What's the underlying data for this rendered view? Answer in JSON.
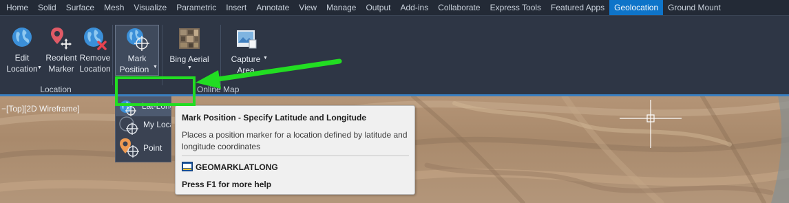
{
  "tabs": [
    {
      "label": "Home",
      "active": false
    },
    {
      "label": "Solid",
      "active": false
    },
    {
      "label": "Surface",
      "active": false
    },
    {
      "label": "Mesh",
      "active": false
    },
    {
      "label": "Visualize",
      "active": false
    },
    {
      "label": "Parametric",
      "active": false
    },
    {
      "label": "Insert",
      "active": false
    },
    {
      "label": "Annotate",
      "active": false
    },
    {
      "label": "View",
      "active": false
    },
    {
      "label": "Manage",
      "active": false
    },
    {
      "label": "Output",
      "active": false
    },
    {
      "label": "Add-ins",
      "active": false
    },
    {
      "label": "Collaborate",
      "active": false
    },
    {
      "label": "Express Tools",
      "active": false
    },
    {
      "label": "Featured Apps",
      "active": false
    },
    {
      "label": "Geolocation",
      "active": true
    },
    {
      "label": "Ground Mount",
      "active": false
    }
  ],
  "location_panel": {
    "title": "Location",
    "edit_location": {
      "line1": "Edit",
      "line2": "Location"
    },
    "reorient_marker": {
      "line1": "Reorient",
      "line2": "Marker"
    },
    "remove_location": {
      "line1": "Remove",
      "line2": "Location"
    }
  },
  "mark_position": {
    "line1": "Mark",
    "line2": "Position"
  },
  "online_map_panel": {
    "title": "Online Map",
    "bing_aerial": "Bing Aerial",
    "capture_area": {
      "line1": "Capture",
      "line2": "Area"
    }
  },
  "viewport": {
    "label": "[Top][2D Wireframe]",
    "minus": "−"
  },
  "dropdown_items": [
    {
      "label": "Lat-Long",
      "icon": "globe-crosshair-icon"
    },
    {
      "label": "My Location",
      "icon": "globe-crosshair-icon"
    },
    {
      "label": "Point",
      "icon": "pin-crosshair-icon"
    }
  ],
  "tooltip": {
    "title": "Mark Position - Specify Latitude and Longitude",
    "description": "Places a position marker for a location defined by latitude and longitude coordinates",
    "command": "GEOMARKLATLONG",
    "help": "Press F1 for more help"
  },
  "colors": {
    "active_tab": "#0e74c9",
    "highlight": "#22dd22",
    "arrow": "#22dd22"
  }
}
